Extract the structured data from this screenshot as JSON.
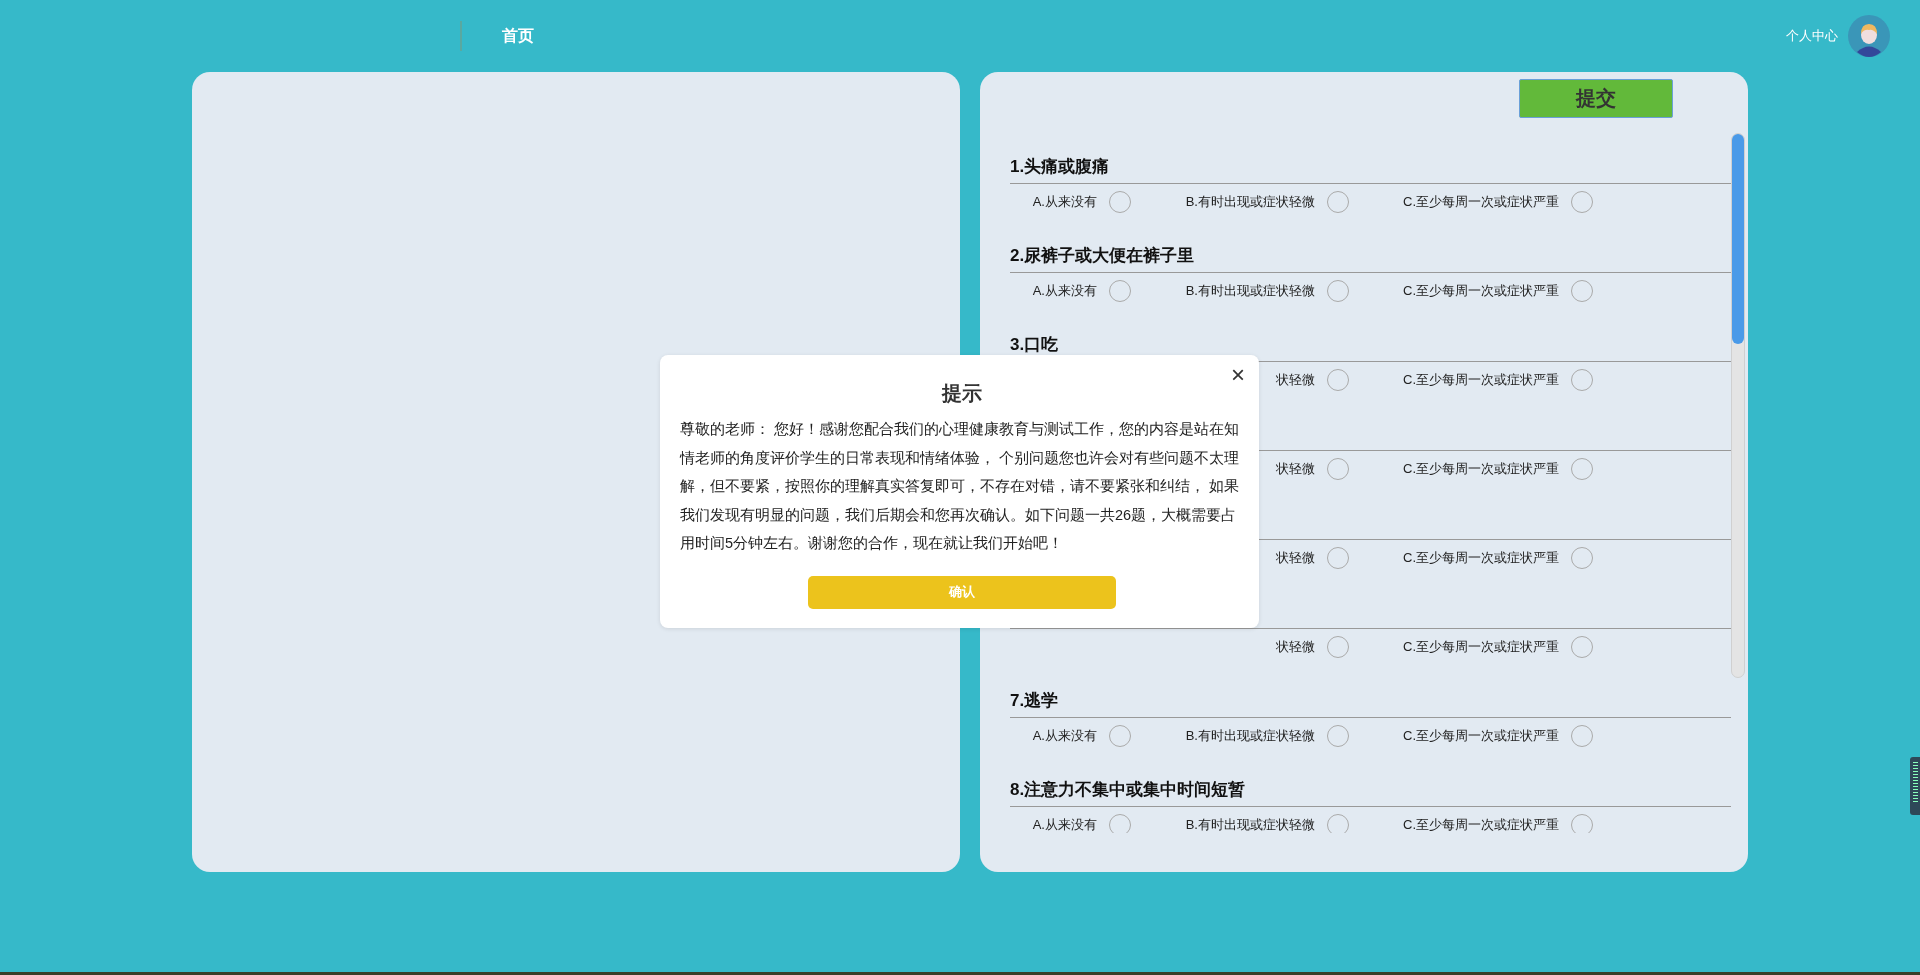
{
  "header": {
    "nav": [
      {
        "label": "首页"
      }
    ],
    "user_link": "个人中心"
  },
  "questionnaire": {
    "submit": "提交",
    "questions": [
      {
        "title": "1.头痛或腹痛",
        "options": [
          {
            "label": "A.从来没有",
            "selected": false
          },
          {
            "label": "B.有时出现或症状轻微",
            "selected": false
          },
          {
            "label": "C.至少每周一次或症状严重",
            "selected": false
          }
        ]
      },
      {
        "title": "2.尿裤子或大便在裤子里",
        "options": [
          {
            "label": "A.从来没有",
            "selected": false
          },
          {
            "label": "B.有时出现或症状轻微",
            "selected": false
          },
          {
            "label": "C.至少每周一次或症状严重",
            "selected": false
          }
        ]
      },
      {
        "title": "3.口吃",
        "options": [
          {
            "label": "状轻微",
            "selected": false
          },
          {
            "label": "C.至少每周一次或症状严重",
            "selected": false
          }
        ]
      },
      {
        "options": [
          {
            "label": "状轻微",
            "selected": false
          },
          {
            "label": "C.至少每周一次或症状严重",
            "selected": false
          }
        ]
      },
      {
        "options": [
          {
            "label": "状轻微",
            "selected": false
          },
          {
            "label": "C.至少每周一次或症状严重",
            "selected": false
          }
        ]
      },
      {
        "options": [
          {
            "label": "状轻微",
            "selected": false
          },
          {
            "label": "C.至少每周一次或症状严重",
            "selected": false
          }
        ]
      },
      {
        "title": "7.逃学",
        "options": [
          {
            "label": "A.从来没有",
            "selected": false
          },
          {
            "label": "B.有时出现或症状轻微",
            "selected": false
          },
          {
            "label": "C.至少每周一次或症状严重",
            "selected": false
          }
        ]
      },
      {
        "title": "8.注意力不集中或集中时间短暂",
        "options": [
          {
            "label": "A.从来没有",
            "selected": false
          },
          {
            "label": "B.有时出现或症状轻微",
            "selected": false
          },
          {
            "label": "C.至少每周一次或症状严重",
            "selected": false
          }
        ]
      }
    ]
  },
  "dialog": {
    "title": "提示",
    "close": "×",
    "message": "尊敬的老师： 您好！感谢您配合我们的心理健康教育与测试工作，您的内容是站在知情老师的角度评价学生的日常表现和情绪体验， 个别问题您也许会对有些问题不太理解，但不要紧，按照你的理解真实答复即可，不存在对错，请不要紧张和纠结， 如果我们发现有明显的问题，我们后期会和您再次确认。如下问题一共26题，大概需要占用时间5分钟左右。谢谢您的合作，现在就让我们开始吧！",
    "confirm": "确认"
  }
}
